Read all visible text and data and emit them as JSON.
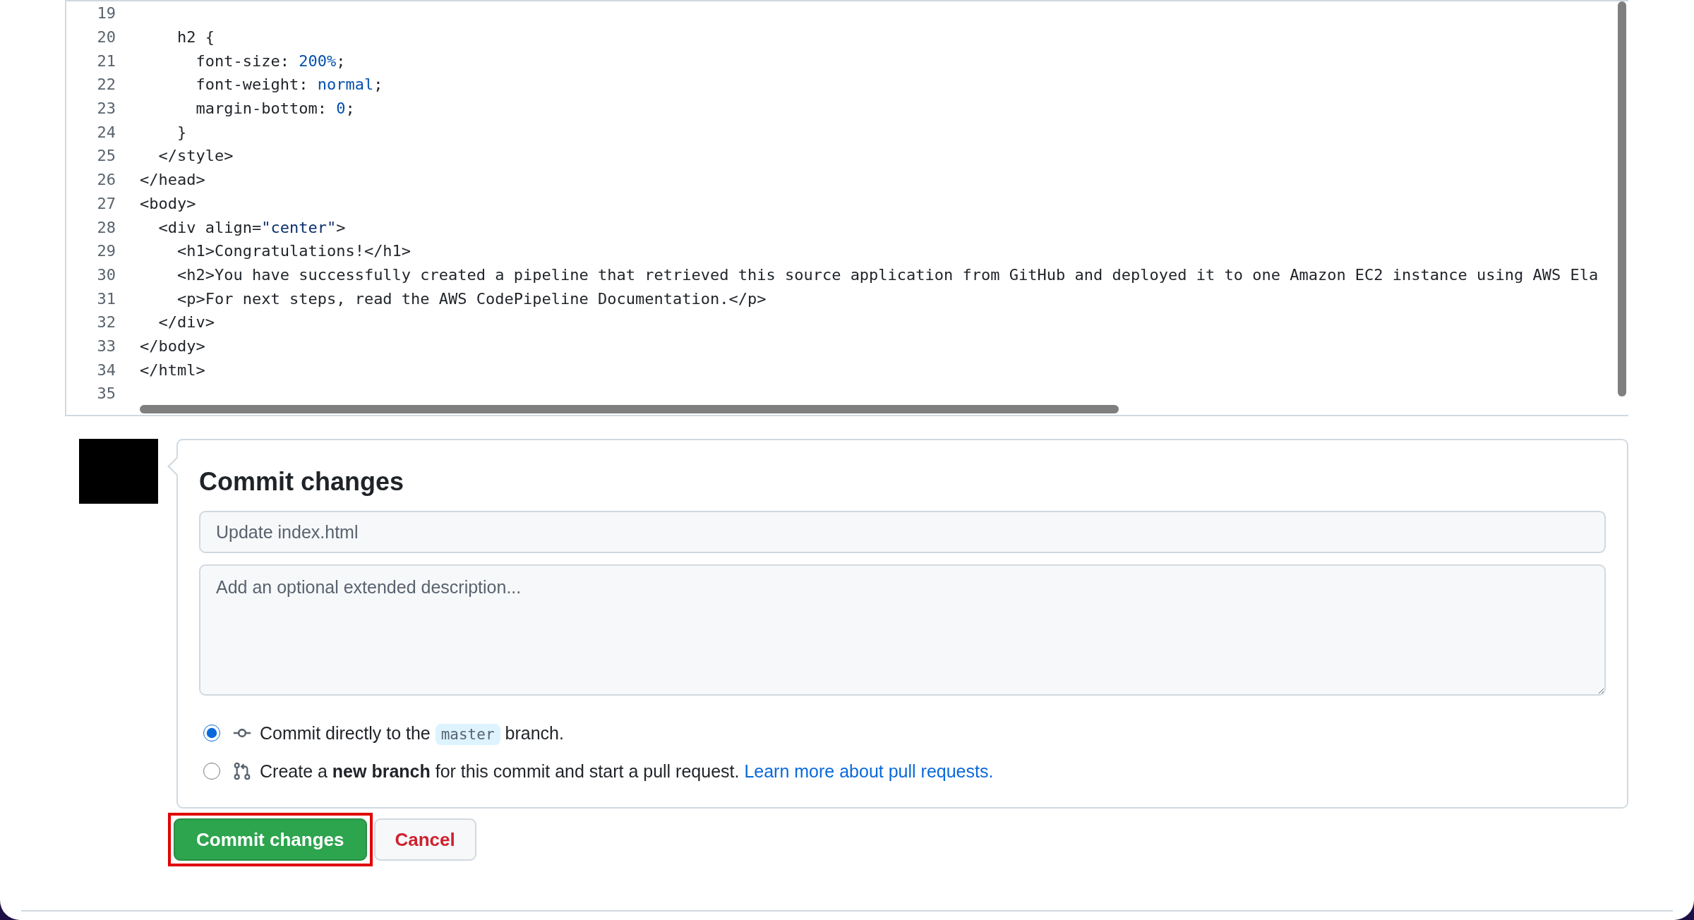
{
  "code": {
    "lines": [
      {
        "number": "19"
      },
      {
        "number": "20",
        "tokens": [
          {
            "text": "    h2 {",
            "kind": "plain"
          }
        ]
      },
      {
        "number": "21",
        "tokens": [
          {
            "text": "      font-size: ",
            "kind": "plain"
          },
          {
            "text": "200%",
            "kind": "value"
          },
          {
            "text": ";",
            "kind": "plain"
          }
        ]
      },
      {
        "number": "22",
        "tokens": [
          {
            "text": "      font-weight: ",
            "kind": "plain"
          },
          {
            "text": "normal",
            "kind": "value"
          },
          {
            "text": ";",
            "kind": "plain"
          }
        ]
      },
      {
        "number": "23",
        "tokens": [
          {
            "text": "      margin-bottom: ",
            "kind": "plain"
          },
          {
            "text": "0",
            "kind": "value"
          },
          {
            "text": ";",
            "kind": "plain"
          }
        ]
      },
      {
        "number": "24",
        "tokens": [
          {
            "text": "    }",
            "kind": "plain"
          }
        ]
      },
      {
        "number": "25",
        "tokens": [
          {
            "text": "  </style>",
            "kind": "plain"
          }
        ]
      },
      {
        "number": "26",
        "tokens": [
          {
            "text": "</head>",
            "kind": "plain"
          }
        ]
      },
      {
        "number": "27",
        "tokens": [
          {
            "text": "<body>",
            "kind": "plain"
          }
        ]
      },
      {
        "number": "28",
        "tokens": [
          {
            "text": "  <div align=",
            "kind": "plain"
          },
          {
            "text": "\"center\"",
            "kind": "string"
          },
          {
            "text": ">",
            "kind": "plain"
          }
        ]
      },
      {
        "number": "29",
        "tokens": [
          {
            "text": "    <h1>Congratulations!</h1>",
            "kind": "plain"
          }
        ]
      },
      {
        "number": "30",
        "tokens": [
          {
            "text": "    <h2>You have successfully created a pipeline that retrieved this source application from GitHub and deployed it to one Amazon EC2 instance using AWS Ela",
            "kind": "plain"
          }
        ]
      },
      {
        "number": "31",
        "tokens": [
          {
            "text": "    <p>For next steps, read the AWS CodePipeline Documentation.</p>",
            "kind": "plain"
          }
        ]
      },
      {
        "number": "32",
        "tokens": [
          {
            "text": "  </div>",
            "kind": "plain"
          }
        ]
      },
      {
        "number": "33",
        "tokens": [
          {
            "text": "</body>",
            "kind": "plain"
          }
        ]
      },
      {
        "number": "34",
        "tokens": [
          {
            "text": "</html>",
            "kind": "plain"
          }
        ]
      },
      {
        "number": "35"
      }
    ]
  },
  "commit": {
    "title": "Commit changes",
    "summary": {
      "placeholder": "Update index.html"
    },
    "description": {
      "placeholder": "Add an optional extended description..."
    },
    "options": [
      {
        "kind": "direct",
        "selected": true,
        "text_before": "Commit directly to the",
        "branch": "master",
        "text_after": "branch."
      },
      {
        "kind": "new-branch",
        "selected": false,
        "text": "Create a **new branch** for this commit and start a pull request.",
        "link": "Learn more about pull requests."
      }
    ]
  },
  "buttons": [
    {
      "kind": "primary",
      "label": "Commit changes",
      "highlighted": true
    },
    {
      "kind": "cancel",
      "label": "Cancel",
      "highlighted": false
    }
  ]
}
